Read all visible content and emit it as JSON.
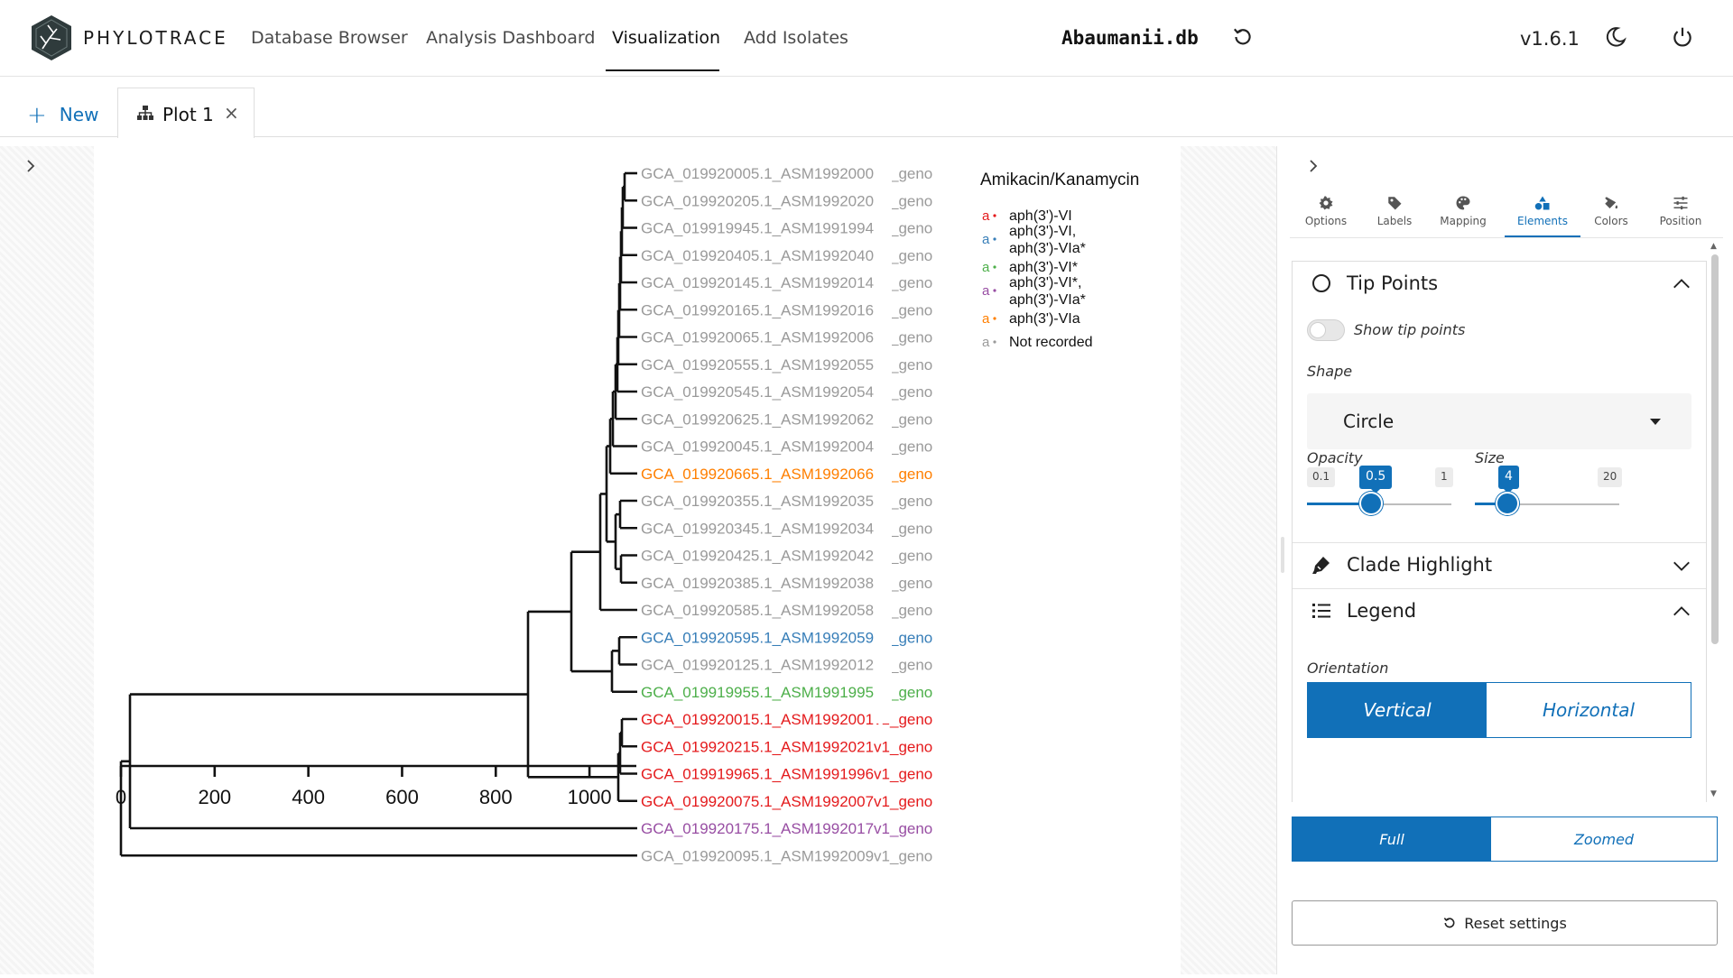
{
  "app": {
    "brand": "PHYLOTRACE",
    "database": "Abaumanii.db",
    "version": "v1.6.1"
  },
  "nav": {
    "links": [
      "Database Browser",
      "Analysis Dashboard",
      "Visualization",
      "Add Isolates"
    ],
    "active": "Visualization"
  },
  "tabs": {
    "new_label": "New",
    "plot_tab_label": "Plot 1",
    "close_glyph": "×"
  },
  "panel": {
    "tabs": [
      "Options",
      "Labels",
      "Mapping",
      "Elements",
      "Colors",
      "Position"
    ],
    "active_tab": "Elements",
    "tip_points": {
      "title": "Tip Points",
      "toggle_label": "Show tip points",
      "toggle_on": false,
      "shape_label": "Shape",
      "shape_value": "Circle",
      "opacity": {
        "label": "Opacity",
        "min": "0.1",
        "max": "1",
        "value": "0.5",
        "fraction": 0.4444
      },
      "size": {
        "label": "Size",
        "min": "",
        "max": "20",
        "value": "4",
        "fraction": 0.2353
      }
    },
    "clade_highlight": {
      "title": "Clade Highlight"
    },
    "legend": {
      "title": "Legend",
      "orientation_label": "Orientation",
      "options": [
        "Vertical",
        "Horizontal"
      ],
      "selected": "Vertical"
    },
    "view_mode": {
      "options": [
        "Full",
        "Zoomed"
      ],
      "selected": "Full"
    },
    "reset_label": "Reset settings"
  },
  "colors": {
    "accent": "#1170b8",
    "tip_gray": "#9a9a9a",
    "red": "#e41a1c",
    "blue": "#377eb8",
    "green": "#4daf4a",
    "purple": "#984ea3",
    "orange": "#ff7f00"
  },
  "chart_data": {
    "type": "tree",
    "legend": {
      "title": "Amikacin/Kanamycin",
      "entries": [
        {
          "lines": [
            "aph(3')-VI"
          ],
          "color": "#e41a1c",
          "key_glyph": "a"
        },
        {
          "lines": [
            "aph(3')-VI,",
            "aph(3')-VIa*"
          ],
          "color": "#377eb8",
          "key_glyph": "a"
        },
        {
          "lines": [
            "aph(3')-VI*"
          ],
          "color": "#4daf4a",
          "key_glyph": "a"
        },
        {
          "lines": [
            "aph(3')-VI*,",
            "aph(3')-VIa*"
          ],
          "color": "#984ea3",
          "key_glyph": "a"
        },
        {
          "lines": [
            "aph(3')-VIa"
          ],
          "color": "#ff7f00",
          "key_glyph": "a"
        },
        {
          "lines": [
            "Not recorded"
          ],
          "color": "#9a9a9a",
          "key_glyph": "a"
        }
      ]
    },
    "x_axis": {
      "ticks": [
        0,
        200,
        400,
        600,
        800,
        1000
      ],
      "range": [
        0,
        1100
      ]
    },
    "tips": [
      {
        "label": "GCA_019920005.1_ASM1992000v1_geno",
        "color": "#9a9a9a"
      },
      {
        "label": "GCA_019920205.1_ASM1992020v1_geno",
        "color": "#9a9a9a"
      },
      {
        "label": "GCA_019919945.1_ASM1991994v1_geno",
        "color": "#9a9a9a"
      },
      {
        "label": "GCA_019920405.1_ASM1992040v1_geno",
        "color": "#9a9a9a"
      },
      {
        "label": "GCA_019920145.1_ASM1992014v1_geno",
        "color": "#9a9a9a"
      },
      {
        "label": "GCA_019920165.1_ASM1992016v1_geno",
        "color": "#9a9a9a"
      },
      {
        "label": "GCA_019920065.1_ASM1992006v1_geno",
        "color": "#9a9a9a"
      },
      {
        "label": "GCA_019920555.1_ASM1992055v1_geno",
        "color": "#9a9a9a"
      },
      {
        "label": "GCA_019920545.1_ASM1992054v1_geno",
        "color": "#9a9a9a"
      },
      {
        "label": "GCA_019920625.1_ASM1992062v1_geno",
        "color": "#9a9a9a"
      },
      {
        "label": "GCA_019920045.1_ASM1992004v1_geno",
        "color": "#9a9a9a"
      },
      {
        "label": "GCA_019920665.1_ASM1992066v1_geno",
        "color": "#ff7f00"
      },
      {
        "label": "GCA_019920355.1_ASM1992035v1_geno",
        "color": "#9a9a9a"
      },
      {
        "label": "GCA_019920345.1_ASM1992034v1_geno",
        "color": "#9a9a9a"
      },
      {
        "label": "GCA_019920425.1_ASM1992042v1_geno",
        "color": "#9a9a9a"
      },
      {
        "label": "GCA_019920385.1_ASM1992038v1_geno",
        "color": "#9a9a9a"
      },
      {
        "label": "GCA_019920585.1_ASM1992058v1_geno",
        "color": "#9a9a9a"
      },
      {
        "label": "GCA_019920595.1_ASM1992059v1_geno",
        "color": "#377eb8"
      },
      {
        "label": "GCA_019920125.1_ASM1992012v1_geno",
        "color": "#9a9a9a"
      },
      {
        "label": "GCA_019919955.1_ASM1991995v1_geno",
        "color": "#4daf4a"
      },
      {
        "label": "GCA_019920015.1_ASM1992001v1_geno",
        "color": "#e41a1c"
      },
      {
        "label": "GCA_019920215.1_ASM1992021v1_geno",
        "color": "#e41a1c"
      },
      {
        "label": "GCA_019919965.1_ASM1991996v1_geno",
        "color": "#e41a1c"
      },
      {
        "label": "GCA_019920075.1_ASM1992007v1_geno",
        "color": "#e41a1c"
      },
      {
        "label": "GCA_019920175.1_ASM1992017v1_geno",
        "color": "#984ea3"
      },
      {
        "label": "GCA_019920095.1_ASM1992009v1_geno",
        "color": "#9a9a9a"
      }
    ]
  }
}
